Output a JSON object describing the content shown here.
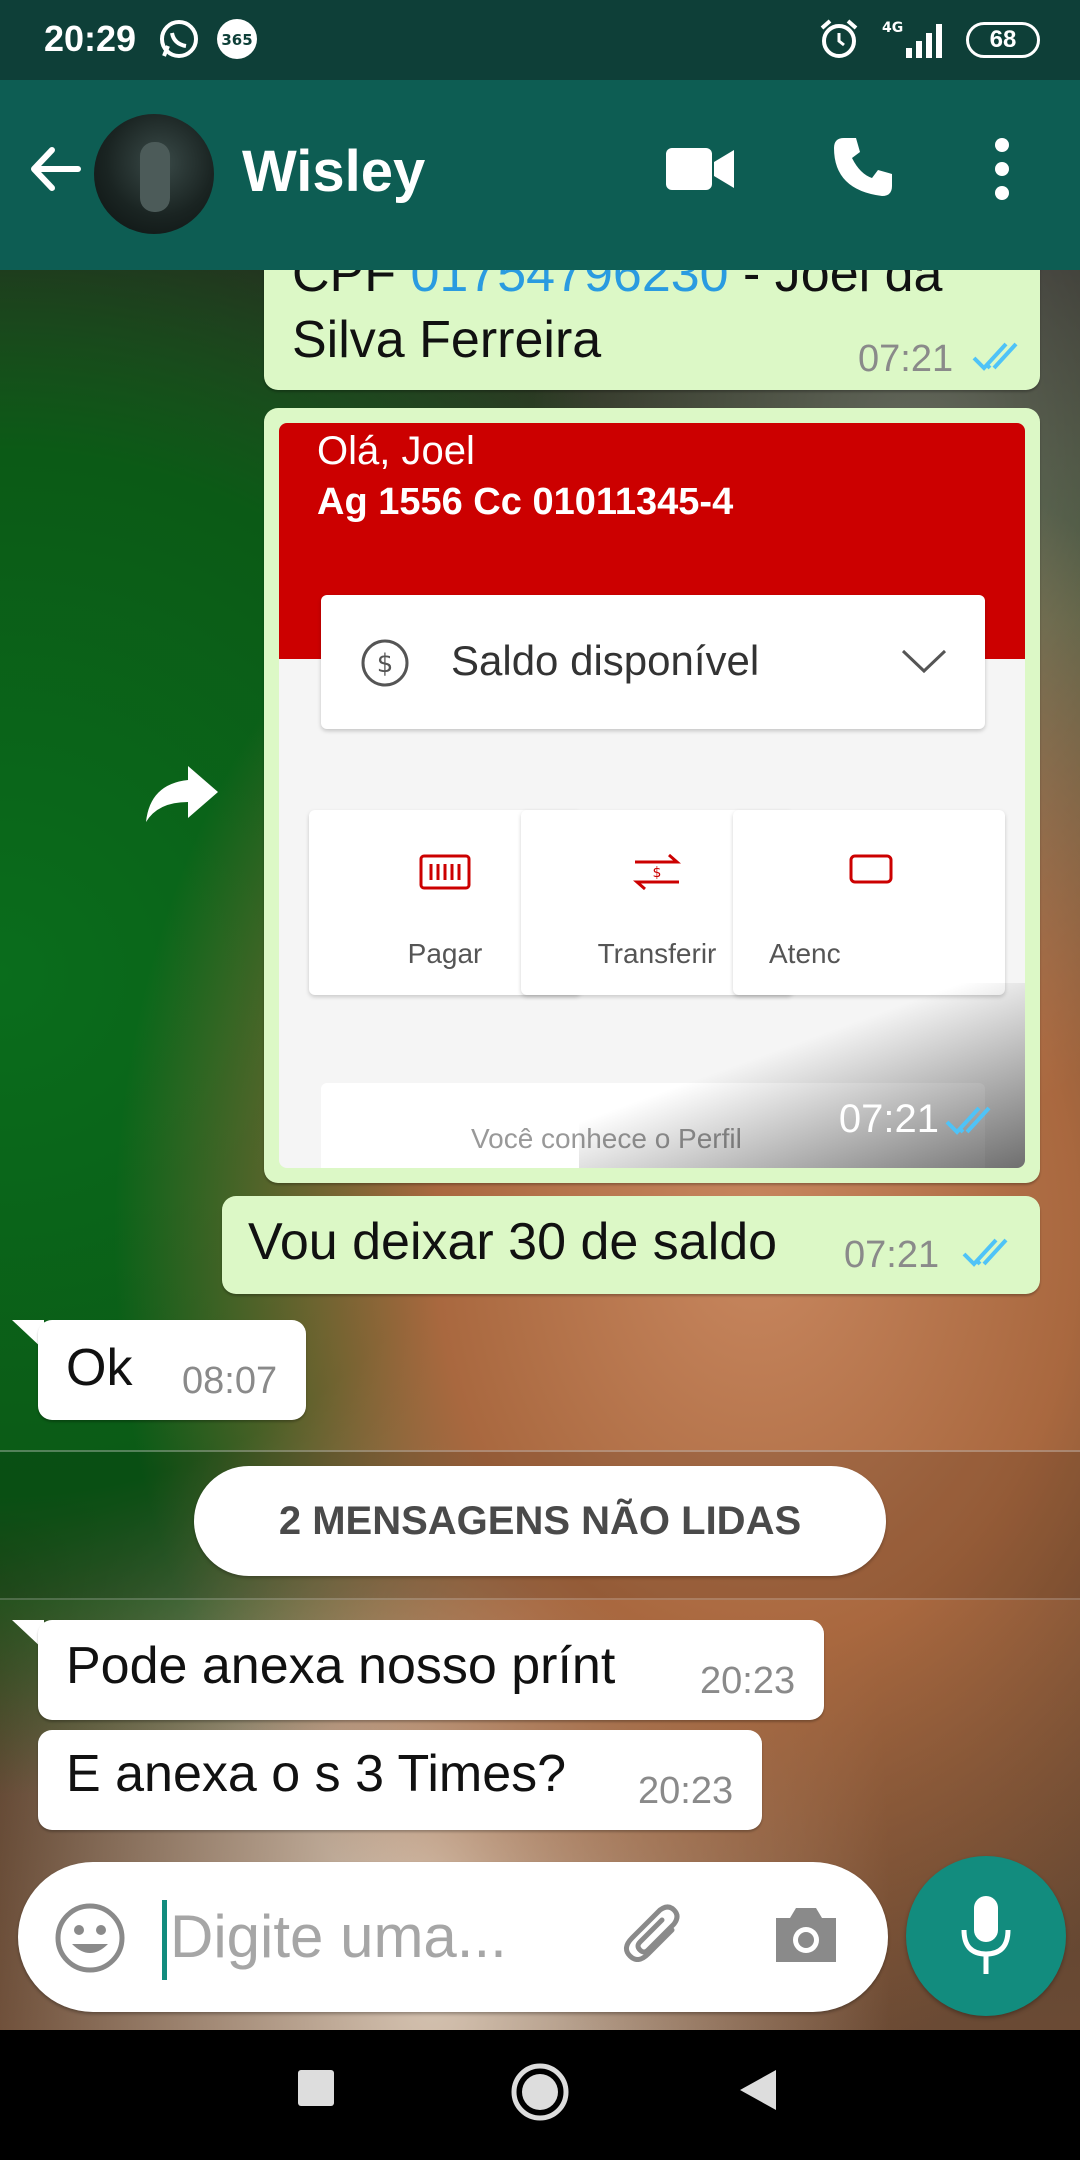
{
  "status_bar": {
    "time": "20:29",
    "battery": "68",
    "network": "4G"
  },
  "header": {
    "contact_name": "Wisley",
    "icons": [
      "back-arrow-icon",
      "video-call-icon",
      "phone-call-icon",
      "more-options-icon"
    ]
  },
  "messages": [
    {
      "direction": "out",
      "text_prefix": "CPF ",
      "text_link": "01754796230",
      "text_suffix": " - Joel da",
      "text_line2": "Silva Ferreira",
      "time": "07:21",
      "status": "read"
    },
    {
      "direction": "out",
      "type": "image",
      "time": "07:21",
      "status": "read",
      "image": {
        "greeting": "Olá, Joel",
        "account": "Ag 1556  Cc 01011345-4",
        "balance_label": "Saldo disponível",
        "tiles": [
          "Pagar",
          "Transferir",
          "Atenc"
        ],
        "bottom_partial": "Você conhece o Perfil"
      }
    },
    {
      "direction": "out",
      "text": "Vou deixar 30 de saldo",
      "time": "07:21",
      "status": "read"
    },
    {
      "direction": "in",
      "text": "Ok",
      "time": "08:07"
    },
    {
      "direction": "in",
      "text": "Pode anexa nosso prínt",
      "time": "20:23"
    },
    {
      "direction": "in",
      "text": "E anexa o s 3 Times?",
      "time": "20:23"
    }
  ],
  "unread_banner": "2 MENSAGENS NÃO LIDAS",
  "composer": {
    "placeholder": "Digite uma...",
    "icons": [
      "emoji-icon",
      "attach-icon",
      "camera-icon",
      "mic-icon"
    ]
  },
  "colors": {
    "header": "#0d5d53",
    "statusbar": "#0e3f38",
    "outgoing_bubble": "#dcf8c6",
    "incoming_bubble": "#ffffff",
    "read_ticks": "#4fc3f7",
    "accent": "#128c7e",
    "bank_red": "#cc0000"
  }
}
